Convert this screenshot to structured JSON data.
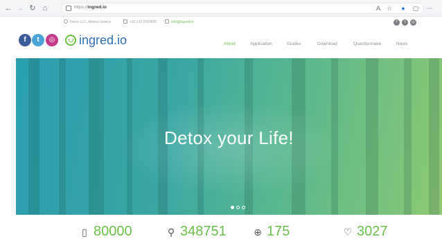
{
  "browser": {
    "url_protocol": "https://",
    "url_host": "ingred.io",
    "icons": [
      "back-icon",
      "forward-icon",
      "refresh-icon",
      "home-icon",
      "read-aloud-icon",
      "favorites-icon",
      "extension-icon",
      "collections-icon",
      "settings-icon"
    ]
  },
  "info_bar": {
    "address": "Detox LLC, Athens Greece",
    "phone": "+30 210 2200692",
    "email": "info@ingred.io"
  },
  "header": {
    "social": {
      "facebook": "f",
      "twitter": "t",
      "instagram": "◎"
    },
    "logo_text": "ingred.io",
    "menu": [
      {
        "label": "About",
        "active": true
      },
      {
        "label": "Application",
        "active": false
      },
      {
        "label": "Guides",
        "active": false
      },
      {
        "label": "Download",
        "active": false
      },
      {
        "label": "Questionnaire",
        "active": false
      },
      {
        "label": "News",
        "active": false
      }
    ]
  },
  "hero": {
    "title": "Detox your Life!",
    "slides": 3,
    "active_slide": 0
  },
  "stats": [
    {
      "icon": "phone-icon",
      "value": "80000"
    },
    {
      "icon": "search-icon",
      "value": "348751"
    },
    {
      "icon": "globe-icon",
      "value": "175"
    },
    {
      "icon": "heart-icon",
      "value": "3027"
    }
  ],
  "colors": {
    "accent_green": "#6abf4b",
    "logo_blue": "#2f6fb0",
    "facebook": "#3b5b9b",
    "twitter": "#4aa3d8",
    "instagram": "#c23a8a"
  }
}
